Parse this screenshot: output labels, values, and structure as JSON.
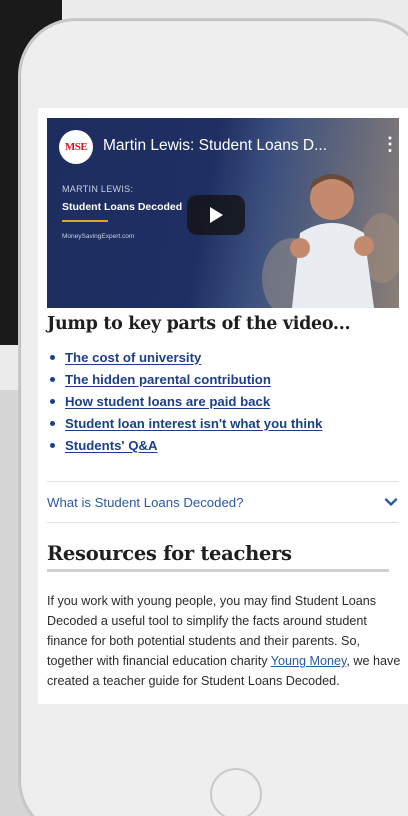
{
  "video": {
    "logo_text": "MSE",
    "title": "Martin Lewis: Student Loans D...",
    "menu_glyph": "⋮",
    "overlay_label": "MARTIN LEWIS:",
    "overlay_title": "Student Loans Decoded",
    "overlay_site": "MoneySavingExpert.com"
  },
  "jump": {
    "heading": "Jump to key parts of the video...",
    "links": [
      "The cost of university",
      "The hidden parental contribution",
      "How student loans are paid back",
      "Student loan interest isn't what you think",
      "Students' Q&A"
    ]
  },
  "accordion": {
    "label": "What is Student Loans Decoded?"
  },
  "resources": {
    "heading": "Resources for teachers",
    "text_before": "If you work with young people, you may find Student Loans Decoded a useful tool to simplify the facts around student finance for both potential students and their parents. So, together with financial education charity ",
    "link": "Young Money",
    "text_after": ", we have created a teacher guide for Student Loans Decoded."
  },
  "colors": {
    "link_blue": "#1d3f8a",
    "accordion_blue": "#2a5aa6",
    "video_navy": "#1e2d5f",
    "accent_gold": "#e1a322",
    "logo_red": "#d7191f"
  }
}
